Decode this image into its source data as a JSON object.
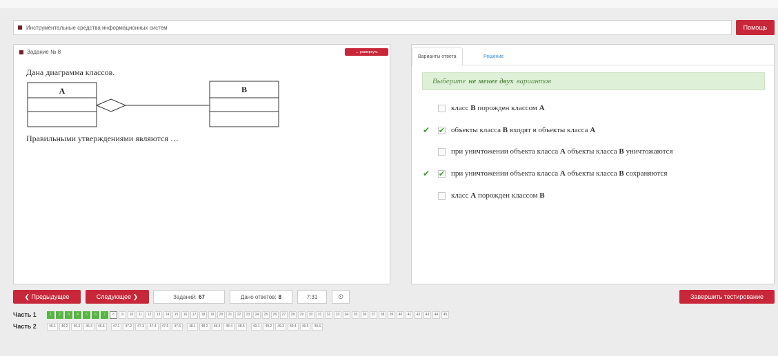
{
  "subject": {
    "title": "Инструментальные средства информационных систем"
  },
  "help_label": "Помощь",
  "task": {
    "heading": "Задание № 8",
    "expand_label": "↔ развернуть",
    "intro": "Дана диаграмма классов.",
    "statement": "Правильными утверждениями являются …",
    "class_a": "A",
    "class_b": "B"
  },
  "answer": {
    "tabs": [
      {
        "label": "Варианты ответа",
        "active": true
      },
      {
        "label": "Решение",
        "active": false
      }
    ],
    "instruction": {
      "before": "Выберите",
      "emph": "не менее двух",
      "after": "вариантов"
    },
    "options": [
      {
        "parts": [
          "класс ",
          "B",
          " порожден классом ",
          "A"
        ],
        "checked": false,
        "correct": false
      },
      {
        "parts": [
          "объекты класса ",
          "B",
          " входят в объекты класса ",
          "A"
        ],
        "checked": true,
        "correct": true
      },
      {
        "parts": [
          "при уничтожении объекта класса ",
          "A",
          " объекты класса ",
          "B",
          " уничтожаются"
        ],
        "checked": false,
        "correct": false
      },
      {
        "parts": [
          "при уничтожении объекта класса ",
          "A",
          " объекты класса ",
          "B",
          " сохраняются"
        ],
        "checked": true,
        "correct": true
      },
      {
        "parts": [
          "класс ",
          "A",
          " порожден классом ",
          "B"
        ],
        "checked": false,
        "correct": false
      }
    ]
  },
  "nav": {
    "prev_label": "❮ Предыдущее",
    "next_label": "Следующее ❯",
    "tasks_label": "Заданий:",
    "tasks_count": "67",
    "answers_label": "Дано ответов:",
    "answers_count": "8",
    "timer": "7:31",
    "finish_label": "Завершить тестирование"
  },
  "parts": {
    "part1_label": "Часть 1",
    "part1_items": [
      "1",
      "2",
      "3",
      "4",
      "5",
      "6",
      "7",
      "8",
      "9",
      "10",
      "11",
      "12",
      "13",
      "14",
      "15",
      "16",
      "17",
      "18",
      "19",
      "20",
      "21",
      "22",
      "23",
      "24",
      "25",
      "26",
      "27",
      "28",
      "29",
      "30",
      "31",
      "32",
      "33",
      "34",
      "35",
      "36",
      "37",
      "38",
      "39",
      "40",
      "41",
      "42",
      "43",
      "44",
      "45"
    ],
    "part1_done": 7,
    "part1_current": 8,
    "part2_label": "Часть 2",
    "part2_groups": [
      [
        "46.1",
        "46.2",
        "46.3",
        "46.4",
        "46.5"
      ],
      [
        "47.1",
        "47.2",
        "47.3",
        "47.4",
        "47.5",
        "47.6"
      ],
      [
        "48.1",
        "48.2",
        "48.3",
        "48.4",
        "48.5"
      ],
      [
        "49.1",
        "49.2",
        "49.3",
        "49.4",
        "49.5",
        "49.6"
      ]
    ]
  }
}
